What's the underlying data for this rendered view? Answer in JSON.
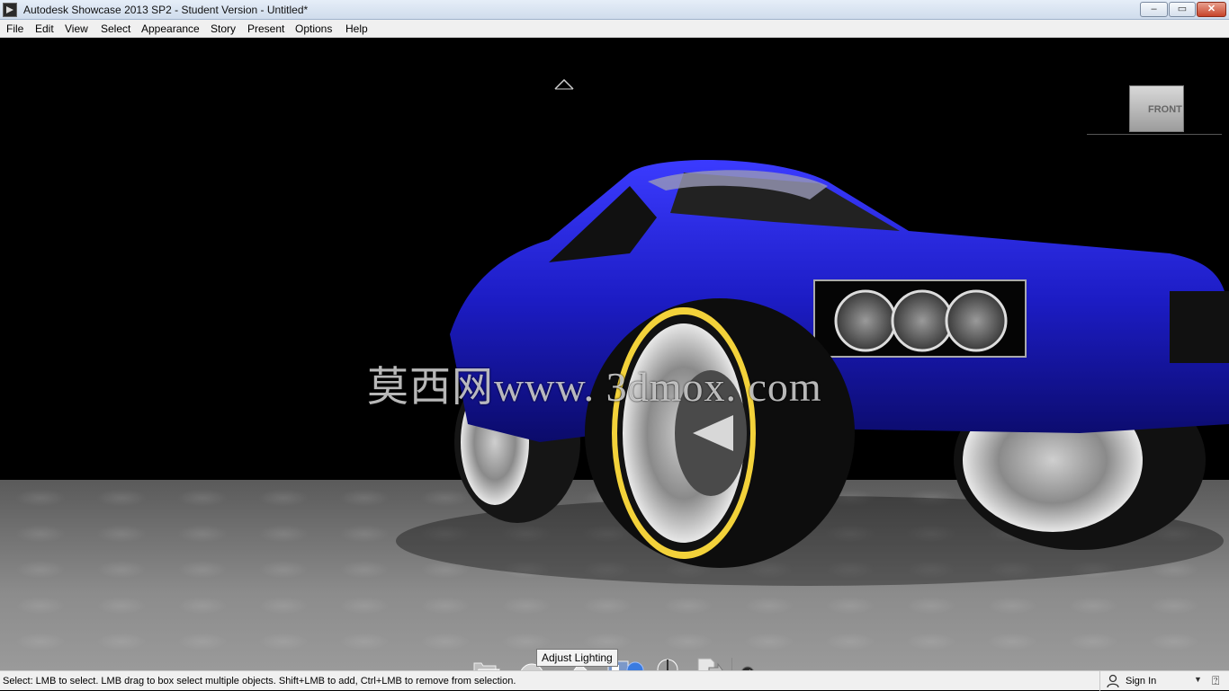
{
  "window": {
    "title": "Autodesk Showcase 2013 SP2 - Student Version - Untitled*",
    "minimize": "–",
    "restore": "▭",
    "close": "✕"
  },
  "menu": [
    "File",
    "Edit",
    "View",
    "Select",
    "Appearance",
    "Story",
    "Present",
    "Options",
    "Help"
  ],
  "viewcube": {
    "label": "FRONT"
  },
  "watermark": "莫西网www. 3dmox. com",
  "toolbar": {
    "tools": [
      "open-icon",
      "environment-dome-icon",
      "lighting-icon",
      "materials-icon",
      "alternatives-icon",
      "export-icon",
      "settings-wrench-icon"
    ],
    "tooltip": "Adjust Lighting"
  },
  "status": {
    "text": "Select: LMB to select. LMB drag to box select multiple objects. Shift+LMB to add, Ctrl+LMB to remove from selection.",
    "sign_in": "Sign In"
  },
  "colors": {
    "car_body": "#1e1ec8",
    "rim_stripe": "#e2c020",
    "floor": "#8c8c8c"
  }
}
